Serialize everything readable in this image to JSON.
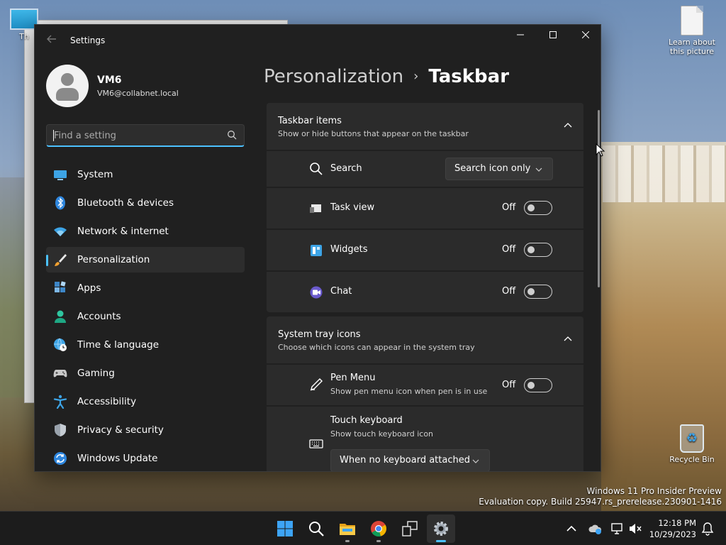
{
  "desktop": {
    "icons": {
      "this_pc": "Th",
      "learn_picture": "Learn about this picture",
      "recycle_bin": "Recycle Bin"
    },
    "watermark": {
      "line1": "Windows 11 Pro Insider Preview",
      "line2": "Evaluation copy. Build 25947.rs_prerelease.230901-1416"
    }
  },
  "window": {
    "title": "Settings",
    "controls": {
      "minimize": "—",
      "maximize": "☐",
      "close": "✕"
    }
  },
  "user": {
    "name": "VM6",
    "email": "VM6@collabnet.local"
  },
  "search": {
    "placeholder": "Find a setting",
    "value": ""
  },
  "nav": {
    "items": [
      {
        "label": "System",
        "icon": "monitor-icon"
      },
      {
        "label": "Bluetooth & devices",
        "icon": "bluetooth-icon"
      },
      {
        "label": "Network & internet",
        "icon": "wifi-icon"
      },
      {
        "label": "Personalization",
        "icon": "brush-icon",
        "active": true
      },
      {
        "label": "Apps",
        "icon": "apps-icon"
      },
      {
        "label": "Accounts",
        "icon": "person-icon"
      },
      {
        "label": "Time & language",
        "icon": "globe-clock-icon"
      },
      {
        "label": "Gaming",
        "icon": "gamepad-icon"
      },
      {
        "label": "Accessibility",
        "icon": "accessibility-icon"
      },
      {
        "label": "Privacy & security",
        "icon": "shield-icon"
      },
      {
        "label": "Windows Update",
        "icon": "update-icon"
      }
    ]
  },
  "breadcrumb": {
    "parent": "Personalization",
    "separator": "›",
    "current": "Taskbar"
  },
  "taskbar_items": {
    "title": "Taskbar items",
    "subtitle": "Show or hide buttons that appear on the taskbar",
    "search": {
      "label": "Search",
      "value": "Search icon only"
    },
    "task_view": {
      "label": "Task view",
      "state": "Off"
    },
    "widgets": {
      "label": "Widgets",
      "state": "Off"
    },
    "chat": {
      "label": "Chat",
      "state": "Off"
    }
  },
  "system_tray": {
    "title": "System tray icons",
    "subtitle": "Choose which icons can appear in the system tray",
    "pen_menu": {
      "label": "Pen Menu",
      "sub": "Show pen menu icon when pen is in use",
      "state": "Off"
    },
    "touch_keyboard": {
      "label": "Touch keyboard",
      "sub": "Show touch keyboard icon",
      "value": "When no keyboard attached"
    }
  },
  "taskbar": {
    "time": "12:18 PM",
    "date": "10/29/2023"
  },
  "colors": {
    "accent": "#4cc2ff",
    "surface": "#2b2b2b",
    "window_bg": "#202020"
  }
}
